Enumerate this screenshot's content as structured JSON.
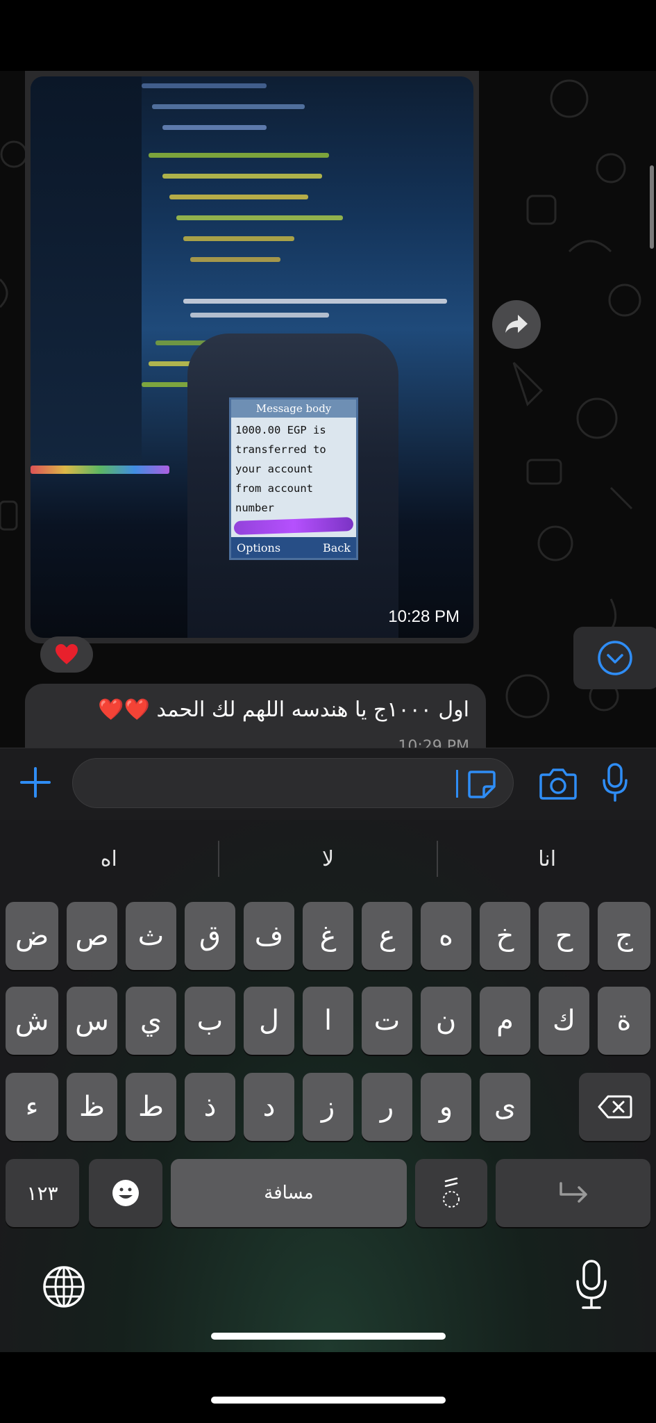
{
  "photo": {
    "screen_title": "Message body",
    "screen_text": "1000.00 EGP is\ntransferred to\nyour account\nfrom account\nnumber",
    "softkey_left": "Options",
    "softkey_right": "Back",
    "timestamp": "10:28 PM"
  },
  "reaction": {
    "emoji": "❤️",
    "icon": "heart-reaction"
  },
  "message": {
    "text": "اول ١٠٠٠ج يا هندسه اللهم لك الحمد ❤️❤️",
    "timestamp": "10:29 PM"
  },
  "icons": {
    "forward": "forward-arrow-icon",
    "scroll_down": "chevron-down-circle-icon",
    "plus": "plus-icon",
    "sticker": "sticker-icon",
    "camera": "camera-icon",
    "mic": "microphone-icon",
    "globe": "globe-icon"
  },
  "composer": {
    "placeholder": ""
  },
  "keyboard": {
    "suggestions": [
      "اه",
      "لا",
      "انا"
    ],
    "row1": [
      "ض",
      "ص",
      "ث",
      "ق",
      "ف",
      "غ",
      "ع",
      "ه",
      "خ",
      "ح",
      "ج"
    ],
    "row2": [
      "ش",
      "س",
      "ي",
      "ب",
      "ل",
      "ا",
      "ت",
      "ن",
      "م",
      "ك",
      "ة"
    ],
    "row3": [
      "ء",
      "ظ",
      "ط",
      "ذ",
      "د",
      "ز",
      "ر",
      "و",
      "ى"
    ],
    "numbers_key": "١٢٣",
    "emoji_key": "😀",
    "space_key": "مسافة",
    "diacritic_key": "ًٍ",
    "return_key": "↵"
  },
  "colors": {
    "accent": "#2f8df5",
    "bubble": "#2e2e30",
    "key": "#5b5b5d"
  }
}
